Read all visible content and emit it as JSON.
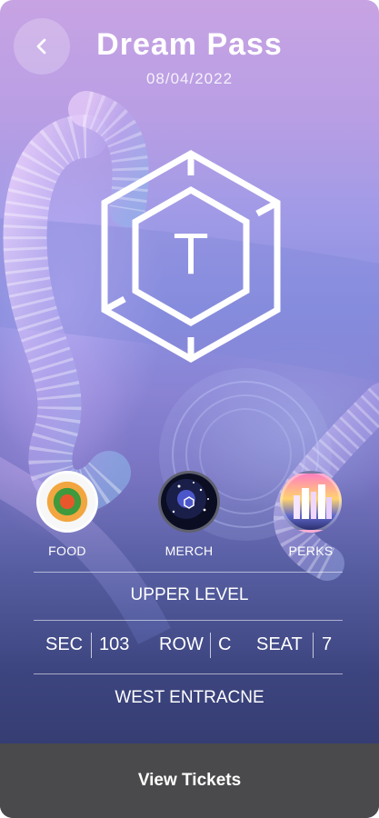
{
  "header": {
    "title": "Dream Pass",
    "date": "08/04/2022",
    "back_icon": "chevron-left-icon"
  },
  "logo": {
    "letter": "T"
  },
  "shortcuts": [
    {
      "label": "FOOD",
      "icon": "food-thumbnail"
    },
    {
      "label": "MERCH",
      "icon": "merch-thumbnail"
    },
    {
      "label": "PERKS",
      "icon": "perks-thumbnail"
    }
  ],
  "ticket": {
    "level": "UPPER LEVEL",
    "section_label": "SEC",
    "section_value": "103",
    "row_label": "ROW",
    "row_value": "C",
    "seat_label": "SEAT",
    "seat_value": "7",
    "entrance": "WEST ENTRACNE"
  },
  "footer": {
    "button_label": "View Tickets"
  },
  "colors": {
    "footer_bg": "#4a4a4c",
    "text": "#ffffff",
    "gradient_top": "#c7a3e3",
    "gradient_bottom": "#2f3566"
  }
}
